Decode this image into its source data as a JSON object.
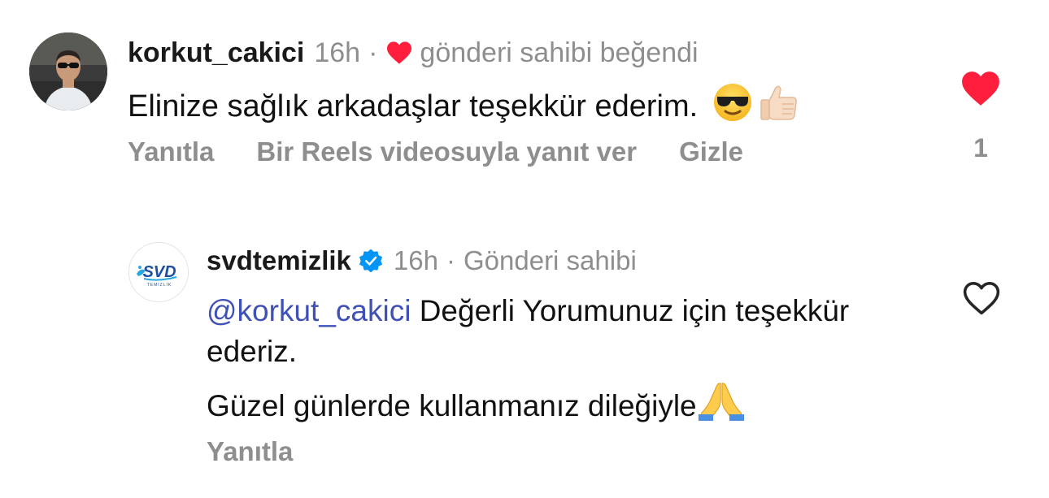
{
  "comment": {
    "avatar_icon": "profile-photo-man-sunglasses",
    "username": "korkut_cakici",
    "time": "16h",
    "separator": "·",
    "owner_liked_label": "gönderi sahibi beğendi",
    "text": "Elinize sağlık arkadaşlar teşekkür ederim.",
    "text_emojis": [
      "smiling-face-with-sunglasses",
      "thumbs-up-light-skin"
    ],
    "actions": {
      "reply": "Yanıtla",
      "reels_reply": "Bir Reels videosuyla yanıt ver",
      "hide": "Gizle"
    },
    "liked": true,
    "like_count": "1",
    "like_color": "#ff1e3c"
  },
  "reply": {
    "avatar_icon": "svd-temizlik-logo",
    "username": "svdtemizlik",
    "verified_icon": "verified-badge-icon",
    "time": "16h",
    "separator": "·",
    "owner_label": "Gönderi sahibi",
    "mention": "@korkut_cakici",
    "text_line1_rest": " Değerli Yorumunuz için teşekkür ederiz.",
    "text_line2": "Güzel günlerde kullanmanız dileğiyle",
    "text_line2_emoji": "folded-hands",
    "actions": {
      "reply": "Yanıtla"
    },
    "liked": false,
    "mention_color": "#3f51b5",
    "verified_color": "#0095f6"
  }
}
